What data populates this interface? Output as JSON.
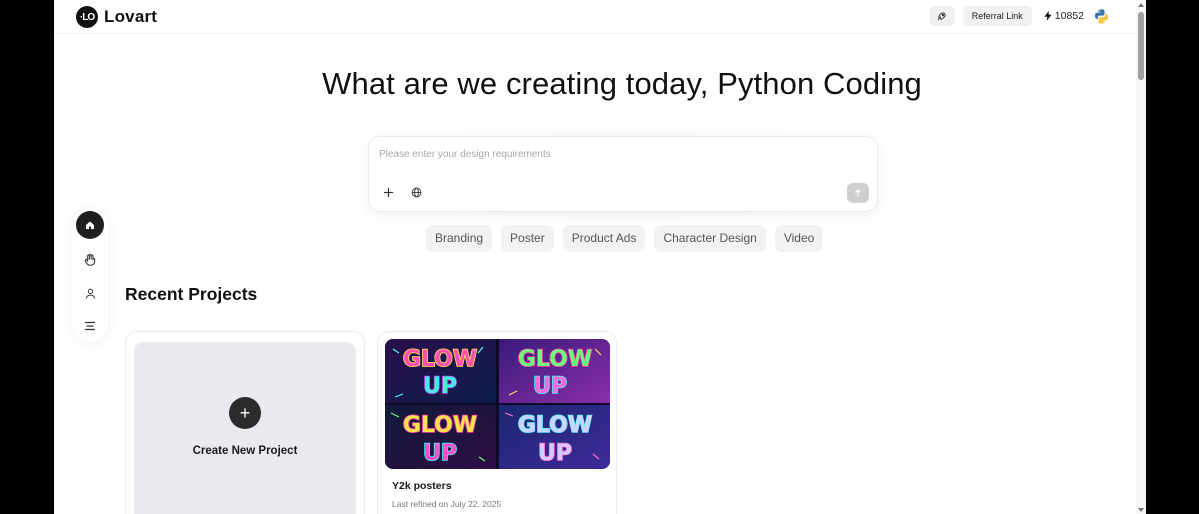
{
  "app": {
    "logo_mark": "·LO",
    "name": "Lovart"
  },
  "header": {
    "referral_label": "Referral Link",
    "credits": "10852",
    "icons": [
      "rocket-icon",
      "bolt-icon",
      "python-avatar"
    ]
  },
  "hero": {
    "title": "What are we creating today, Python Coding"
  },
  "prompt": {
    "placeholder": "Please enter your design requirements",
    "value": "",
    "icons": [
      "plus-icon",
      "globe-icon",
      "send-arrow-icon"
    ]
  },
  "chips": [
    "Branding",
    "Poster",
    "Product Ads",
    "Character Design",
    "Video"
  ],
  "sidenav": {
    "items": [
      "home-icon",
      "hand-icon",
      "user-icon",
      "menu-icon"
    ]
  },
  "recent": {
    "title": "Recent Projects",
    "create_label": "Create New Project",
    "projects": [
      {
        "title": "Y2k posters",
        "date": "Last refined on July 22, 2025",
        "thumb_text": [
          "GLOW",
          "UP"
        ]
      }
    ]
  },
  "colors": {
    "accent_dark": "#1f1f1f",
    "chip_bg": "#f2f2f2",
    "card_placeholder": "#e9eaee"
  }
}
